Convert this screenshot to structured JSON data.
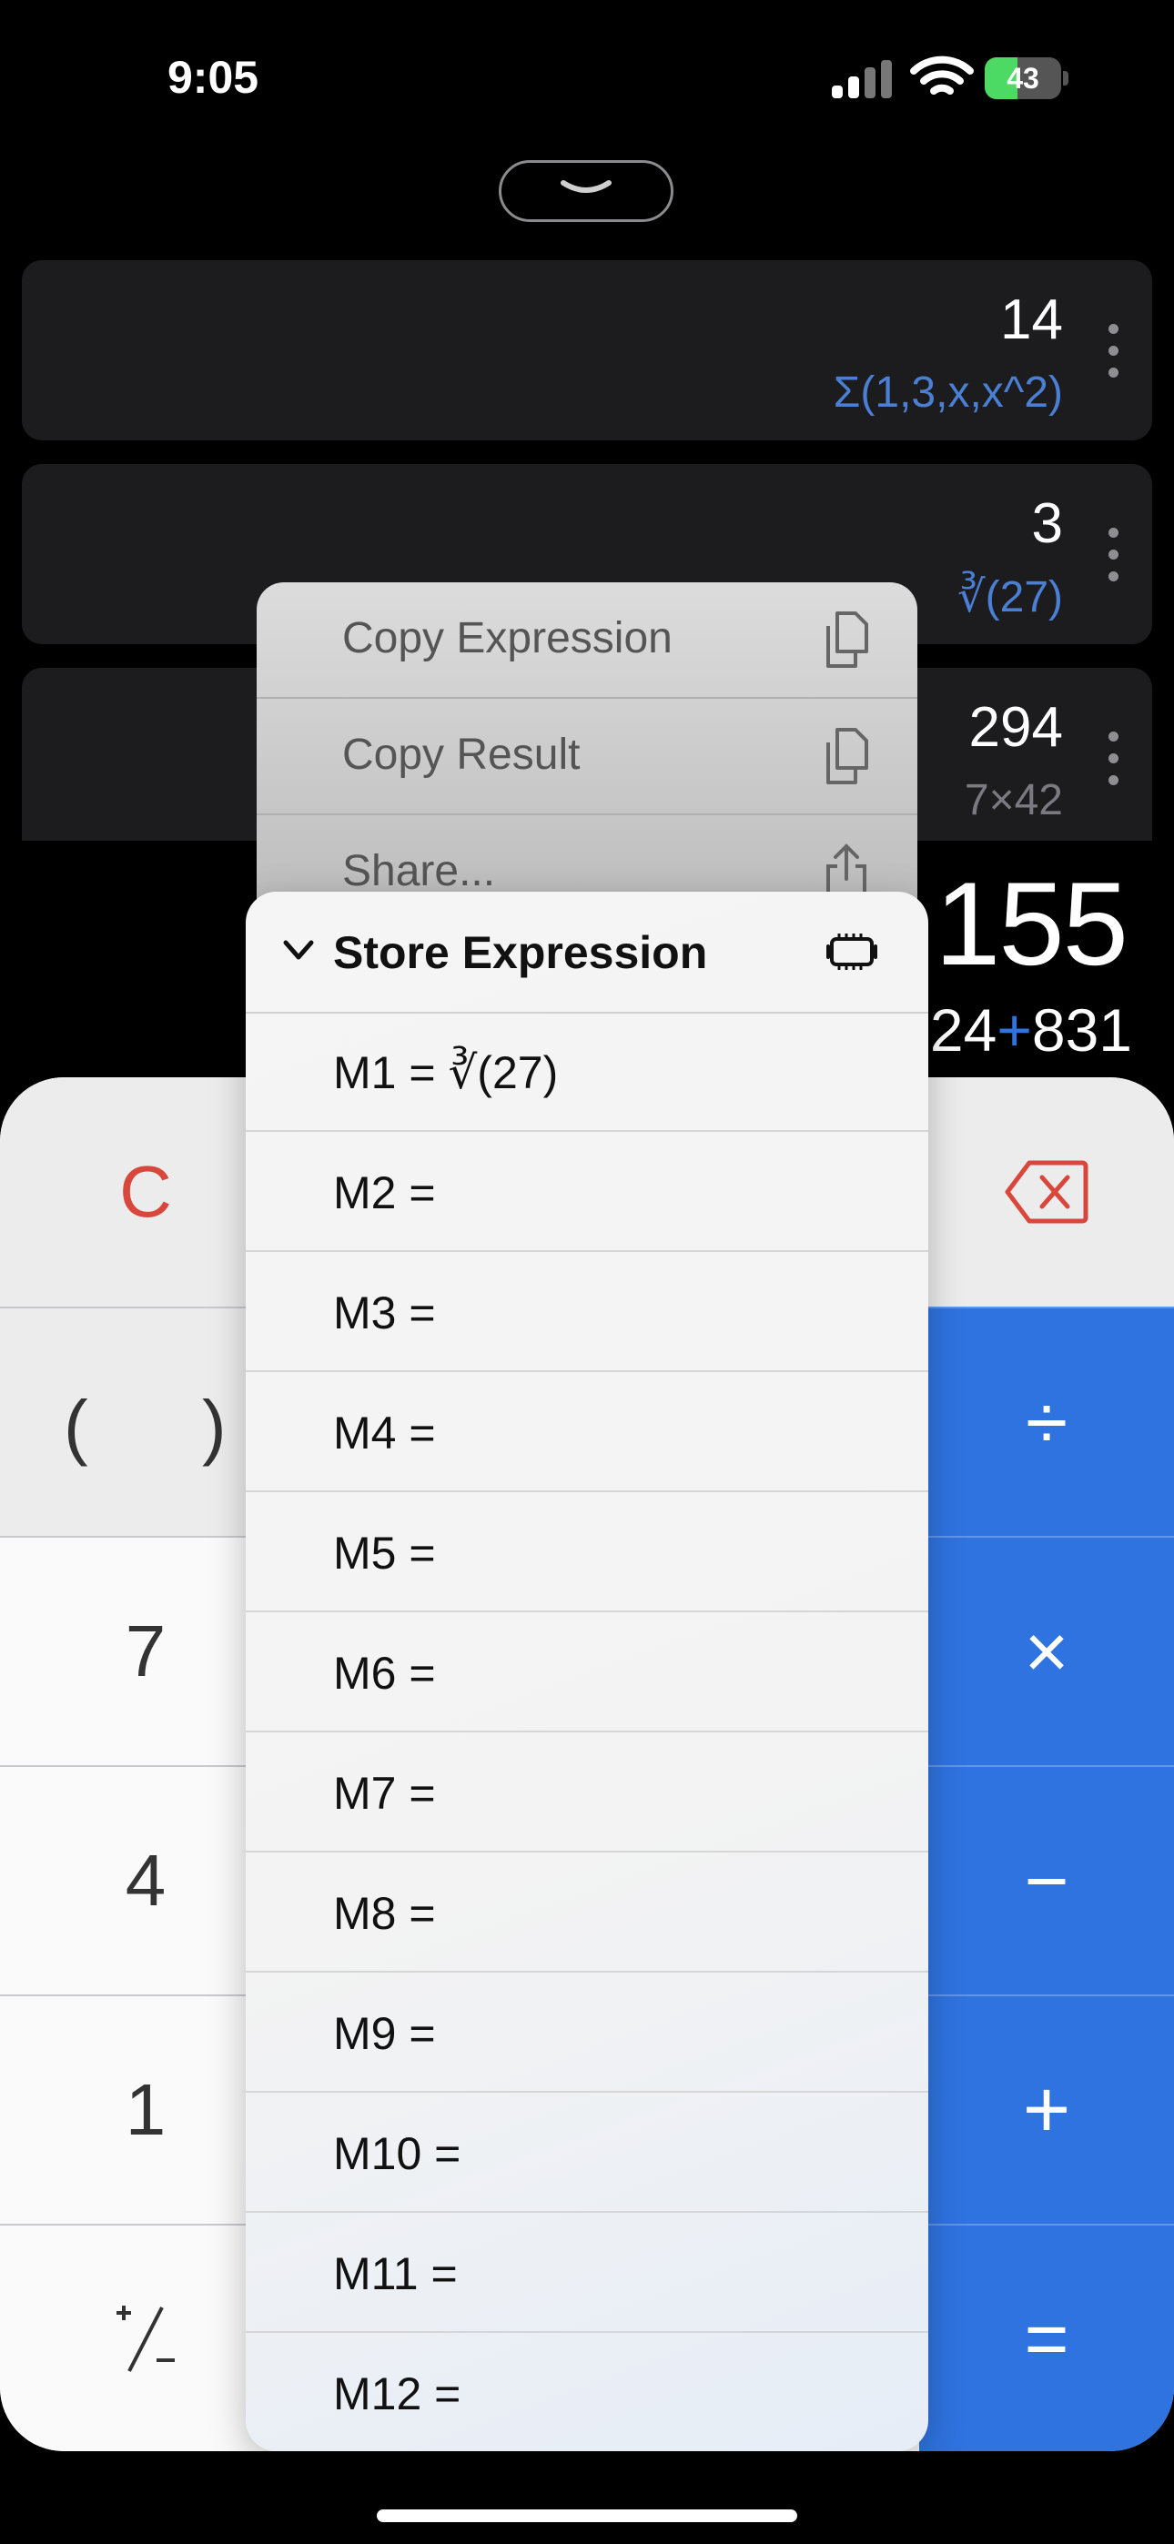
{
  "status_bar": {
    "time": "9:05",
    "battery": "43",
    "battery_level": 0.43,
    "charging": true
  },
  "history": [
    {
      "result": "14",
      "expression": "Σ(1,3,x,x^2)",
      "expression_color": "#4a7fd4"
    },
    {
      "result": "3",
      "expression": "∛(27)",
      "expression_color": "#4a7fd4"
    },
    {
      "result": "294",
      "expression": "7×42",
      "expression_color": "#7a7a80"
    }
  ],
  "current": {
    "result": ",155",
    "expr_left": "24",
    "expr_op": "+",
    "expr_right": "831"
  },
  "context_menu": {
    "items": [
      {
        "label": "Copy Expression",
        "icon": "copy-icon"
      },
      {
        "label": "Copy Result",
        "icon": "copy-icon"
      },
      {
        "label": "Share...",
        "icon": "share-icon"
      }
    ]
  },
  "store_menu": {
    "title": "Store Expression",
    "icon": "memory-chip-icon",
    "items": [
      "M1 = ∛(27)",
      "M2 =",
      "M3 =",
      "M4 =",
      "M5 =",
      "M6 =",
      "M7 =",
      "M8 =",
      "M9 =",
      "M10 =",
      "M11 =",
      "M12 ="
    ]
  },
  "keypad": {
    "clear": "C",
    "paren_open": "(",
    "paren_close": ")",
    "seven": "7",
    "four": "4",
    "one": "1",
    "plus_minus": "+/−",
    "divide": "÷",
    "multiply": "×",
    "minus": "−",
    "plus": "+",
    "equals": "=",
    "accent": "#2f73e0",
    "clear_color": "#d9473c"
  }
}
